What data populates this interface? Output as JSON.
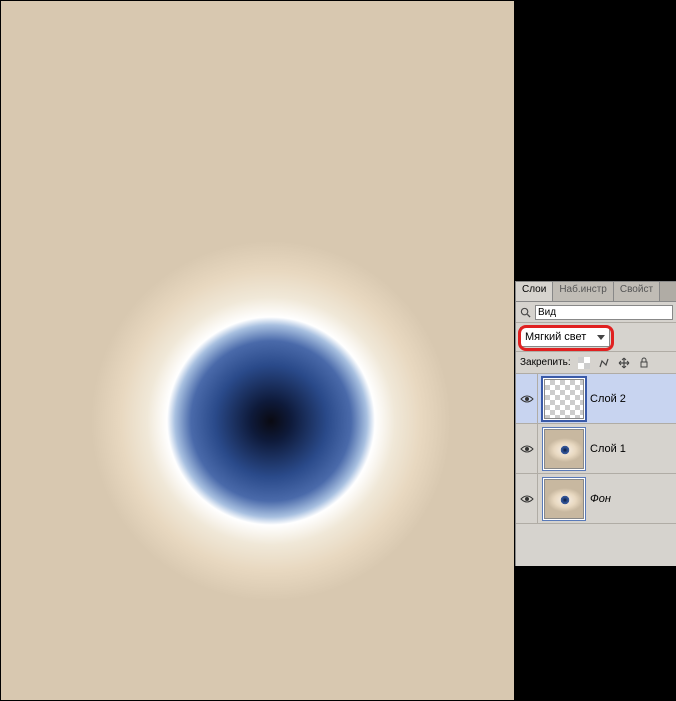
{
  "panel": {
    "tabs": [
      {
        "label": "Слои",
        "active": true
      },
      {
        "label": "Наб.инстр",
        "active": false
      },
      {
        "label": "Свойст",
        "active": false
      }
    ],
    "view_filter_value": "Вид",
    "blend_mode": "Мягкий свет",
    "lock_label": "Закрепить:"
  },
  "layers": [
    {
      "name": "Слой 2",
      "selected": true,
      "thumb": "checker",
      "italic": false
    },
    {
      "name": "Слой 1",
      "selected": false,
      "thumb": "eye",
      "italic": false
    },
    {
      "name": "Фон",
      "selected": false,
      "thumb": "eye",
      "italic": true
    }
  ]
}
